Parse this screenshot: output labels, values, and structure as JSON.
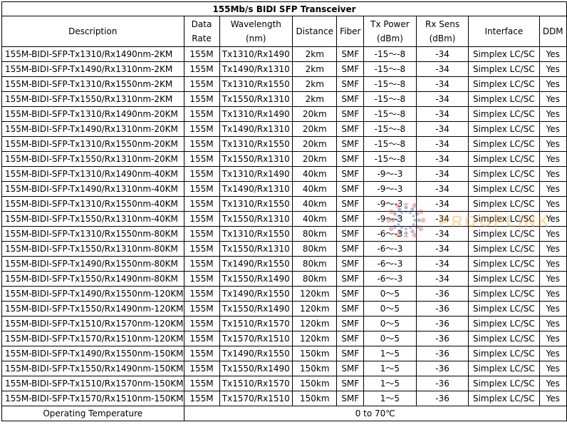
{
  "title": "155Mb/s BIDI SFP Transceiver",
  "headers": {
    "description": "Description",
    "data_rate_1": "Data",
    "data_rate_2": "Rate",
    "wavelength_1": "Wavelength",
    "wavelength_2": "(nm)",
    "distance": "Distance",
    "fiber": "Fiber",
    "tx_power_1": "Tx Power",
    "tx_power_2": "(dBm)",
    "rx_sens_1": "Rx Sens",
    "rx_sens_2": "(dBm)",
    "interface": "Interface",
    "ddm": "DDM"
  },
  "rows": [
    [
      "155M-BIDI-SFP-Tx1310/Rx1490nm-2KM",
      "155M",
      "Tx1310/Rx1490",
      "2km",
      "SMF",
      "-15～-8",
      "-34",
      "Simplex LC/SC",
      "Yes"
    ],
    [
      "155M-BIDI-SFP-Tx1490/Rx1310nm-2KM",
      "155M",
      "Tx1490/Rx1310",
      "2km",
      "SMF",
      "-15～-8",
      "-34",
      "Simplex LC/SC",
      "Yes"
    ],
    [
      "155M-BIDI-SFP-Tx1310/Rx1550nm-2KM",
      "155M",
      "Tx1310/Rx1550",
      "2km",
      "SMF",
      "-15～-8",
      "-34",
      "Simplex LC/SC",
      "Yes"
    ],
    [
      "155M-BIDI-SFP-Tx1550/Rx1310nm-2KM",
      "155M",
      "Tx1550/Rx1310",
      "2km",
      "SMF",
      "-15～-8",
      "-34",
      "Simplex LC/SC",
      "Yes"
    ],
    [
      "155M-BIDI-SFP-Tx1310/Rx1490nm-20KM",
      "155M",
      "Tx1310/Rx1490",
      "20km",
      "SMF",
      "-15～-8",
      "-34",
      "Simplex LC/SC",
      "Yes"
    ],
    [
      "155M-BIDI-SFP-Tx1490/Rx1310nm-20KM",
      "155M",
      "Tx1490/Rx1310",
      "20km",
      "SMF",
      "-15～-8",
      "-34",
      "Simplex LC/SC",
      "Yes"
    ],
    [
      "155M-BIDI-SFP-Tx1310/Rx1550nm-20KM",
      "155M",
      "Tx1310/Rx1550",
      "20km",
      "SMF",
      "-15～-8",
      "-34",
      "Simplex LC/SC",
      "Yes"
    ],
    [
      "155M-BIDI-SFP-Tx1550/Rx1310nm-20KM",
      "155M",
      "Tx1550/Rx1310",
      "20km",
      "SMF",
      "-15～-8",
      "-34",
      "Simplex LC/SC",
      "Yes"
    ],
    [
      "155M-BIDI-SFP-Tx1310/Rx1490nm-40KM",
      "155M",
      "Tx1310/Rx1490",
      "40km",
      "SMF",
      "-9～-3",
      "-34",
      "Simplex LC/SC",
      "Yes"
    ],
    [
      "155M-BIDI-SFP-Tx1490/Rx1310nm-40KM",
      "155M",
      "Tx1490/Rx1310",
      "40km",
      "SMF",
      "-9～-3",
      "-34",
      "Simplex LC/SC",
      "Yes"
    ],
    [
      "155M-BIDI-SFP-Tx1310/Rx1550nm-40KM",
      "155M",
      "Tx1310/Rx1550",
      "40km",
      "SMF",
      "-9～-3",
      "-34",
      "Simplex LC/SC",
      "Yes"
    ],
    [
      "155M-BIDI-SFP-Tx1550/Rx1310nm-40KM",
      "155M",
      "Tx1550/Rx1310",
      "40km",
      "SMF",
      "-9～-3",
      "-34",
      "Simplex LC/SC",
      "Yes"
    ],
    [
      "155M-BIDI-SFP-Tx1310/Rx1550nm-80KM",
      "155M",
      "Tx1310/Rx1550",
      "80km",
      "SMF",
      "-6～-3",
      "-34",
      "Simplex LC/SC",
      "Yes"
    ],
    [
      "155M-BIDI-SFP-Tx1550/Rx1310nm-80KM",
      "155M",
      "Tx1550/Rx1310",
      "80km",
      "SMF",
      "-6～-3",
      "-34",
      "Simplex LC/SC",
      "Yes"
    ],
    [
      "155M-BIDI-SFP-Tx1490/Rx1550nm-80KM",
      "155M",
      "Tx1490/Rx1550",
      "80km",
      "SMF",
      "-6～-3",
      "-34",
      "Simplex LC/SC",
      "Yes"
    ],
    [
      "155M-BIDI-SFP-Tx1550/Rx1490nm-80KM",
      "155M",
      "Tx1550/Rx1490",
      "80km",
      "SMF",
      "-6～-3",
      "-34",
      "Simplex LC/SC",
      "Yes"
    ],
    [
      "155M-BIDI-SFP-Tx1490/Rx1550nm-120KM",
      "155M",
      "Tx1490/Rx1550",
      "120km",
      "SMF",
      "0～5",
      "-36",
      "Simplex LC/SC",
      "Yes"
    ],
    [
      "155M-BIDI-SFP-Tx1550/Rx1490nm-120KM",
      "155M",
      "Tx1550/Rx1490",
      "120km",
      "SMF",
      "0～5",
      "-36",
      "Simplex LC/SC",
      "Yes"
    ],
    [
      "155M-BIDI-SFP-Tx1510/Rx1570nm-120KM",
      "155M",
      "Tx1510/Rx1570",
      "120km",
      "SMF",
      "0～5",
      "-36",
      "Simplex LC/SC",
      "Yes"
    ],
    [
      "155M-BIDI-SFP-Tx1570/Rx1510nm-120KM",
      "155M",
      "Tx1570/Rx1510",
      "120km",
      "SMF",
      "0～5",
      "-36",
      "Simplex LC/SC",
      "Yes"
    ],
    [
      "155M-BIDI-SFP-Tx1490/Rx1550nm-150KM",
      "155M",
      "Tx1490/Rx1550",
      "150km",
      "SMF",
      "1～5",
      "-36",
      "Simplex LC/SC",
      "Yes"
    ],
    [
      "155M-BIDI-SFP-Tx1550/Rx1490nm-150KM",
      "155M",
      "Tx1550/Rx1490",
      "150km",
      "SMF",
      "1～5",
      "-36",
      "Simplex LC/SC",
      "Yes"
    ],
    [
      "155M-BIDI-SFP-Tx1510/Rx1570nm-150KM",
      "155M",
      "Tx1510/Rx1570",
      "150km",
      "SMF",
      "1～5",
      "-36",
      "Simplex LC/SC",
      "Yes"
    ],
    [
      "155M-BIDI-SFP-Tx1570/Rx1510nm-150KM",
      "155M",
      "Tx1570/Rx1510",
      "150km",
      "SMF",
      "1～5",
      "-36",
      "Simplex LC/SC",
      "Yes"
    ]
  ],
  "footer": {
    "label": "Operating Temperature",
    "value": "0  to  70℃"
  },
  "watermark": {
    "text": "PROOPLINK",
    "color": "#f5a623",
    "icon": "dot-sunburst-icon"
  }
}
